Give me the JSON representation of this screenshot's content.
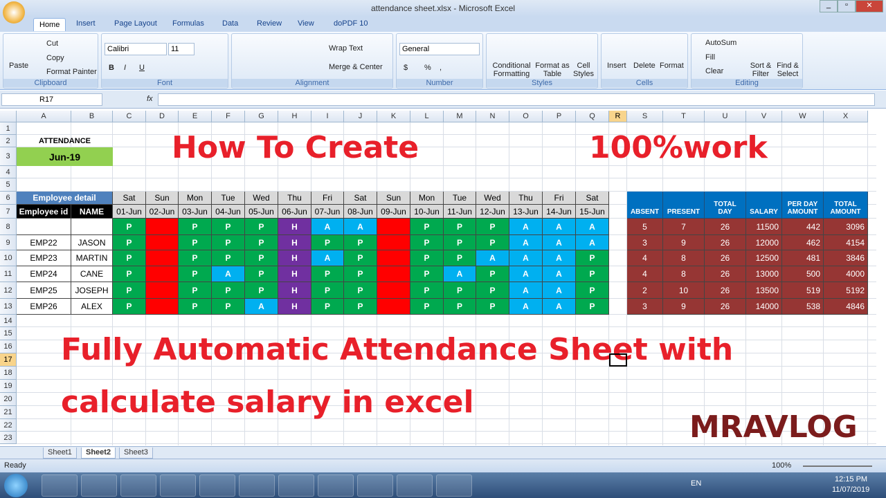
{
  "window": {
    "title": "attendance sheet.xlsx - Microsoft Excel"
  },
  "ribbon_tabs": [
    "Home",
    "Insert",
    "Page Layout",
    "Formulas",
    "Data",
    "Review",
    "View",
    "doPDF 10"
  ],
  "clipboard": {
    "paste": "Paste",
    "cut": "Cut",
    "copy": "Copy",
    "format_painter": "Format Painter",
    "label": "Clipboard"
  },
  "font": {
    "name": "Calibri",
    "size": "11",
    "label": "Font",
    "bold": "B",
    "italic": "I",
    "underline": "U"
  },
  "alignment": {
    "wrap": "Wrap Text",
    "merge": "Merge & Center",
    "label": "Alignment"
  },
  "number": {
    "format": "General",
    "currency": "$",
    "percent": "%",
    "comma": ",",
    "label": "Number"
  },
  "styles": {
    "conditional": "Conditional Formatting",
    "format_table": "Format as Table",
    "cell_styles": "Cell Styles",
    "label": "Styles"
  },
  "cells": {
    "insert": "Insert",
    "delete": "Delete",
    "format": "Format",
    "label": "Cells"
  },
  "editing": {
    "autosum": "AutoSum",
    "fill": "Fill",
    "clear": "Clear",
    "sort": "Sort & Filter",
    "find": "Find & Select",
    "label": "Editing"
  },
  "formula_bar": {
    "name_box": "R17",
    "fx": "fx",
    "value": ""
  },
  "columns": [
    "A",
    "B",
    "C",
    "D",
    "E",
    "F",
    "G",
    "H",
    "I",
    "J",
    "K",
    "L",
    "M",
    "N",
    "O",
    "P",
    "Q",
    "R",
    "S",
    "T",
    "U",
    "V",
    "W",
    "X"
  ],
  "selected": {
    "column": "R",
    "row": "17"
  },
  "sheet": {
    "attendance_label": "ATTENDANCE",
    "month": "Jun-19",
    "employee_detail": "Employee detail",
    "employee_id_header": "Employee id",
    "name_header": "NAME",
    "days": [
      "Sat",
      "Sun",
      "Mon",
      "Tue",
      "Wed",
      "Thu",
      "Fri",
      "Sat",
      "Sun",
      "Mon",
      "Tue",
      "Wed",
      "Thu",
      "Fri",
      "Sat"
    ],
    "dates": [
      "01-Jun",
      "02-Jun",
      "03-Jun",
      "04-Jun",
      "05-Jun",
      "06-Jun",
      "07-Jun",
      "08-Jun",
      "09-Jun",
      "10-Jun",
      "11-Jun",
      "12-Jun",
      "13-Jun",
      "14-Jun",
      "15-Jun"
    ],
    "summary_headers": [
      [
        "",
        "ABSENT"
      ],
      [
        "",
        "PRESENT"
      ],
      [
        "TOTAL",
        "DAY"
      ],
      [
        "",
        "SALARY"
      ],
      [
        "PER DAY",
        "AMOUNT"
      ],
      [
        "TOTAL",
        "AMOUNT"
      ]
    ],
    "employees": [
      {
        "id": "",
        "name": "",
        "marks": [
          "P",
          "",
          "P",
          "P",
          "P",
          "H",
          "A",
          "A",
          "",
          "P",
          "P",
          "P",
          "A",
          "A",
          "A"
        ],
        "summary": [
          "5",
          "7",
          "26",
          "11500",
          "442",
          "3096"
        ]
      },
      {
        "id": "EMP22",
        "name": "JASON",
        "marks": [
          "P",
          "",
          "P",
          "P",
          "P",
          "H",
          "P",
          "P",
          "",
          "P",
          "P",
          "P",
          "A",
          "A",
          "A"
        ],
        "summary": [
          "3",
          "9",
          "26",
          "12000",
          "462",
          "4154"
        ]
      },
      {
        "id": "EMP23",
        "name": "MARTIN",
        "marks": [
          "P",
          "",
          "P",
          "P",
          "P",
          "H",
          "A",
          "P",
          "",
          "P",
          "P",
          "A",
          "A",
          "A",
          "P"
        ],
        "summary": [
          "4",
          "8",
          "26",
          "12500",
          "481",
          "3846"
        ]
      },
      {
        "id": "EMP24",
        "name": "CANE",
        "marks": [
          "P",
          "",
          "P",
          "A",
          "P",
          "H",
          "P",
          "P",
          "",
          "P",
          "A",
          "P",
          "A",
          "A",
          "P"
        ],
        "summary": [
          "4",
          "8",
          "26",
          "13000",
          "500",
          "4000"
        ]
      },
      {
        "id": "EMP25",
        "name": "JOSEPH",
        "marks": [
          "P",
          "",
          "P",
          "P",
          "P",
          "H",
          "P",
          "P",
          "",
          "P",
          "P",
          "P",
          "A",
          "A",
          "P"
        ],
        "summary": [
          "2",
          "10",
          "26",
          "13500",
          "519",
          "5192"
        ]
      },
      {
        "id": "EMP26",
        "name": "ALEX",
        "marks": [
          "P",
          "",
          "P",
          "P",
          "A",
          "H",
          "P",
          "P",
          "",
          "P",
          "P",
          "P",
          "A",
          "A",
          "P"
        ],
        "summary": [
          "3",
          "9",
          "26",
          "14000",
          "538",
          "4846"
        ]
      }
    ],
    "colors": {
      "P": "#00a94f",
      "A": "#00b0f0",
      "H": "#7030a0",
      "sunday": "#ff0000",
      "summary": "#963634",
      "summary_header": "#0070c0",
      "detail_header": "#4f81bd",
      "month": "#92d050"
    }
  },
  "overlay": {
    "title1": "How To Create",
    "title2": "100%work",
    "subtitle1": "Fully Automatic Attendance Sheet with",
    "subtitle2": "calculate salary in excel",
    "brand": "MRAVLOG"
  },
  "sheet_tabs": [
    "Sheet1",
    "Sheet2",
    "Sheet3"
  ],
  "active_sheet": "Sheet2",
  "status": {
    "ready": "Ready",
    "zoom": "100%"
  },
  "taskbar": {
    "lang": "EN",
    "time": "12:15 PM",
    "date": "11/07/2019"
  }
}
